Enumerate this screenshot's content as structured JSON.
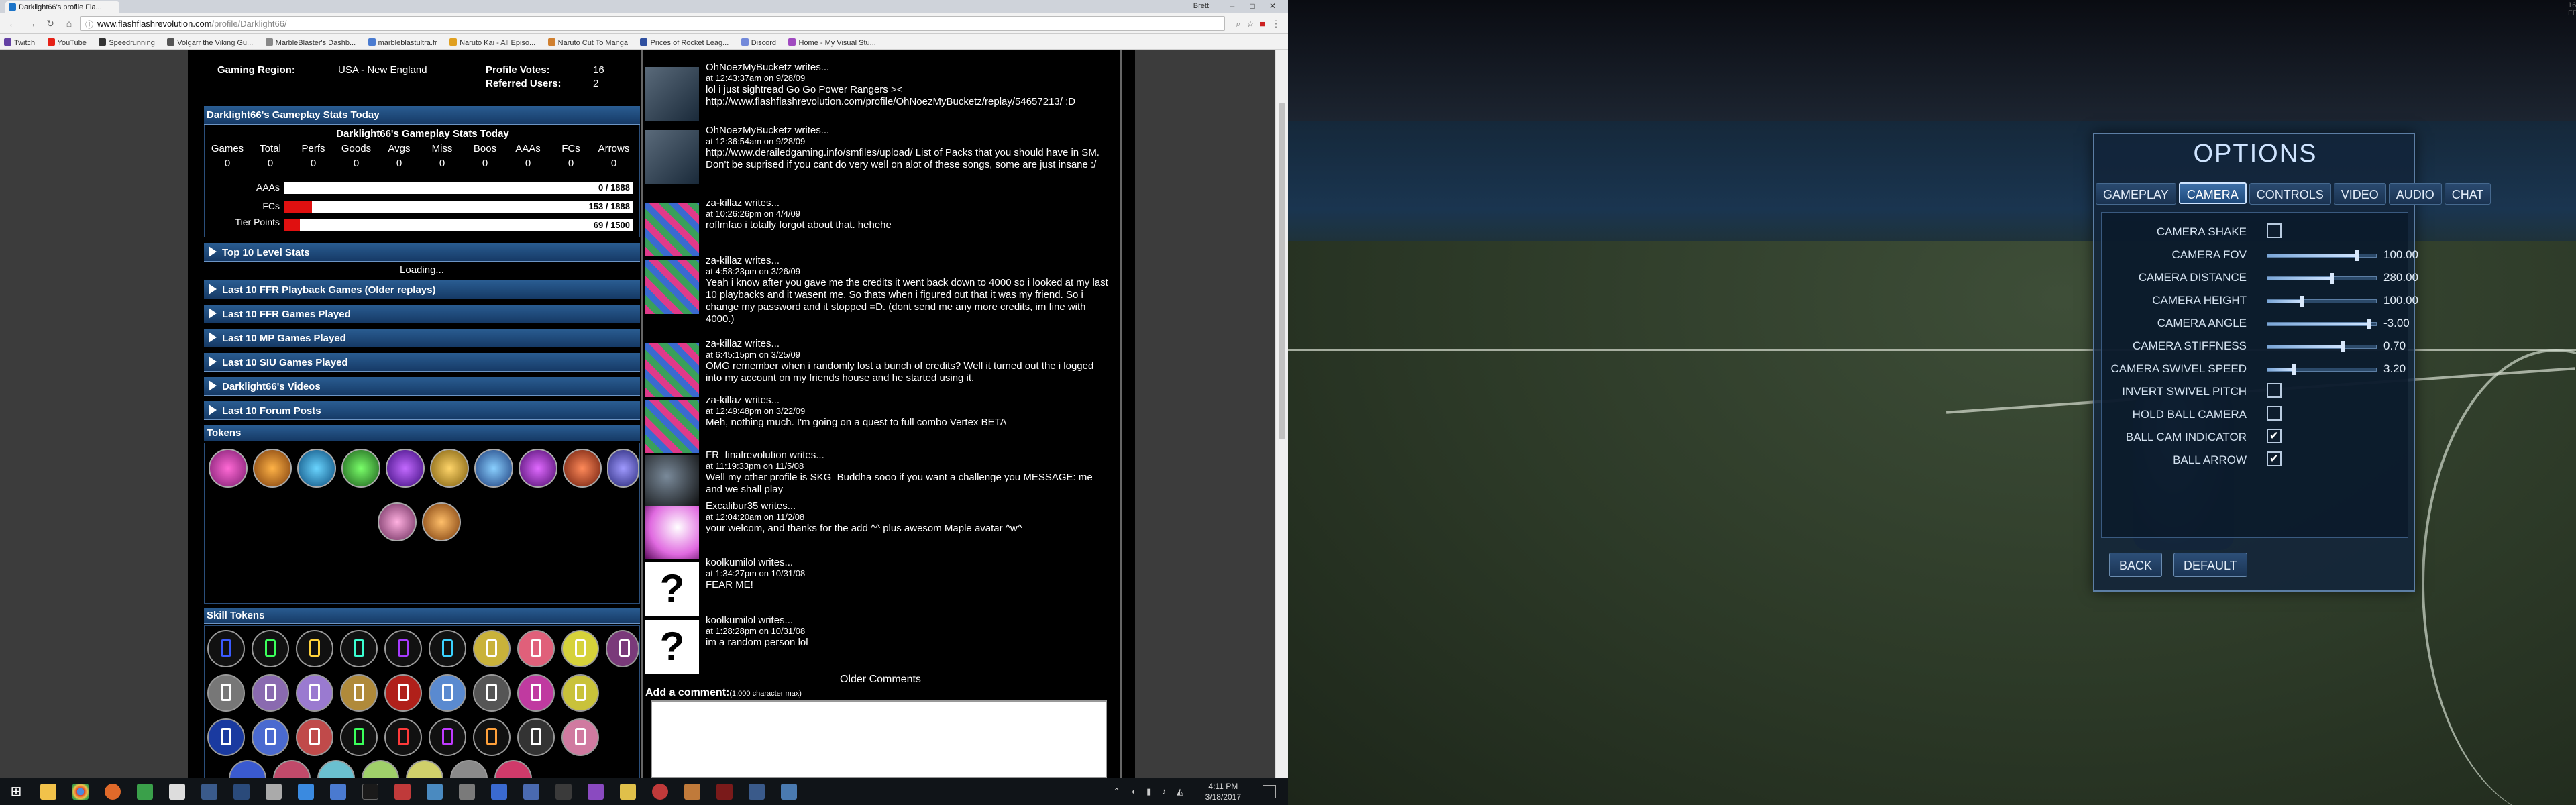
{
  "browser": {
    "tab_title": "Darklight66's profile Fla...",
    "window_user": "Brett",
    "address_host": "www.flashflashrevolution.com",
    "address_path": "/profile/Darklight66/",
    "bookmarks": [
      {
        "label": "Twitch",
        "color": "#6441a4"
      },
      {
        "label": "YouTube",
        "color": "#e62117"
      },
      {
        "label": "Speedrunning",
        "color": "#333333"
      },
      {
        "label": "Volgarr the Viking Gu...",
        "color": "#555555"
      },
      {
        "label": "MarbleBlaster's Dashb...",
        "color": "#888888"
      },
      {
        "label": "marbleblastultra.fr",
        "color": "#4a7bd0"
      },
      {
        "label": "Naruto Kai - All Episo...",
        "color": "#e0a020"
      },
      {
        "label": "Naruto Cut To Manga",
        "color": "#d08030"
      },
      {
        "label": "Prices of Rocket Leag...",
        "color": "#3050a0"
      },
      {
        "label": "Discord",
        "color": "#7289da"
      },
      {
        "label": "Home - My Visual Stu...",
        "color": "#a04ac0"
      }
    ]
  },
  "profile": {
    "region_label": "Gaming Region:",
    "region_value": "USA - New England",
    "votes_label": "Profile Votes:",
    "votes_value": "16",
    "ref_label": "Referred Users:",
    "ref_value": "2",
    "stats_bar": "Darklight66's Gameplay Stats Today",
    "stats_title": "Darklight66's Gameplay Stats Today",
    "stat_headers": [
      "Games",
      "Total",
      "Perfs",
      "Goods",
      "Avgs",
      "Miss",
      "Boos",
      "AAAs",
      "FCs",
      "Arrows"
    ],
    "stat_values": [
      "0",
      "0",
      "0",
      "0",
      "0",
      "0",
      "0",
      "0",
      "0",
      "0"
    ],
    "bars": [
      {
        "label": "AAAs",
        "text": "0 / 1888",
        "fraction": 0.0
      },
      {
        "label": "FCs",
        "text": "153 / 1888",
        "fraction": 0.081
      },
      {
        "label": "Tier Points",
        "text": "69 / 1500",
        "fraction": 0.046
      }
    ],
    "top10": "Top 10 Level Stats",
    "loading": "Loading...",
    "sections": [
      "Last 10 FFR Playback Games (Older replays)",
      "Last 10 FFR Games Played",
      "Last 10 MP Games Played",
      "Last 10 SIU Games Played",
      "Darklight66's Videos",
      "Last 10 Forum Posts"
    ],
    "tokens_label": "Tokens",
    "skill_tokens_label": "Skill Tokens"
  },
  "comments": [
    {
      "who": "OhNoezMyBucketz writes...",
      "when": "at 12:43:37am on 9/28/09",
      "msg": "lol i just sightread Go Go Power Rangers >< http://www.flashflashrevolution.com/profile/OhNoezMyBucketz/replay/54657213/ :D"
    },
    {
      "who": "OhNoezMyBucketz writes...",
      "when": "at 12:36:54am on 9/28/09",
      "msg": "http://www.derailedgaming.info/smfiles/upload/ List of Packs that you should have in SM. Don't be suprised if you cant do very well on alot of these songs, some are just insane :/"
    },
    {
      "who": "za-killaz writes...",
      "when": "at 10:26:26pm on 4/4/09",
      "msg": "roflmfao i totally forgot about that. hehehe"
    },
    {
      "who": "za-killaz writes...",
      "when": "at 4:58:23pm on 3/26/09",
      "msg": "Yeah i know after you gave me the credits it went back down to 4000 so i looked at my last 10 playbacks and it wasent me. So thats when i figured out that it was my friend. So i change my password and it stopped =D. (dont send me any more credits, im fine with 4000.)"
    },
    {
      "who": "za-killaz writes...",
      "when": "at 6:45:15pm on 3/25/09",
      "msg": "OMG remember when i randomly lost a bunch of credits? Well it turned out the i logged into my account on my friends house and he started using it."
    },
    {
      "who": "za-killaz writes...",
      "when": "at 12:49:48pm on 3/22/09",
      "msg": "Meh, nothing much. I'm going on a quest to full combo Vertex BETA"
    },
    {
      "who": "FR_finalrevolution writes...",
      "when": "at 11:19:33pm on 11/5/08",
      "msg": "Well my other profile is SKG_Buddha sooo if you want a challenge you MESSAGE: me and we shall play"
    },
    {
      "who": "Excalibur35 writes...",
      "when": "at 12:04:20am on 11/2/08",
      "msg": "your welcom, and thanks for the add ^^ plus awesom Maple avatar ^w^"
    },
    {
      "who": "koolkumilol writes...",
      "when": "at 1:34:27pm on 10/31/08",
      "msg": "FEAR ME!"
    },
    {
      "who": "koolkumilol writes...",
      "when": "at 1:28:28pm on 10/31/08",
      "msg": "im a random person lol"
    }
  ],
  "older_comments": "Older Comments",
  "add_comment": "Add a comment:",
  "add_comment_note": "(1,000 character max)",
  "clock": {
    "time": "4:11 PM",
    "date": "3/18/2017"
  },
  "game": {
    "fps": "165 FPS",
    "title": "OPTIONS",
    "tabs": [
      "GAMEPLAY",
      "CAMERA",
      "CONTROLS",
      "VIDEO",
      "AUDIO",
      "CHAT"
    ],
    "active_tab": "CAMERA",
    "rows": [
      {
        "label": "CAMERA SHAKE",
        "kind": "check",
        "checked": false
      },
      {
        "label": "CAMERA FOV",
        "kind": "slider",
        "value": "100.00",
        "level": 0.82
      },
      {
        "label": "CAMERA DISTANCE",
        "kind": "slider",
        "value": "280.00",
        "level": 0.6
      },
      {
        "label": "CAMERA HEIGHT",
        "kind": "slider",
        "value": "100.00",
        "level": 0.32
      },
      {
        "label": "CAMERA ANGLE",
        "kind": "slider",
        "value": "-3.00",
        "level": 0.94
      },
      {
        "label": "CAMERA STIFFNESS",
        "kind": "slider",
        "value": "0.70",
        "level": 0.7
      },
      {
        "label": "CAMERA SWIVEL SPEED",
        "kind": "slider",
        "value": "3.20",
        "level": 0.24
      },
      {
        "label": "INVERT SWIVEL PITCH",
        "kind": "check",
        "checked": false
      },
      {
        "label": "HOLD BALL CAMERA",
        "kind": "check",
        "checked": false
      },
      {
        "label": "BALL CAM INDICATOR",
        "kind": "check",
        "checked": true
      },
      {
        "label": "BALL ARROW",
        "kind": "check",
        "checked": true
      }
    ],
    "back": "BACK",
    "default": "DEFAULT"
  }
}
